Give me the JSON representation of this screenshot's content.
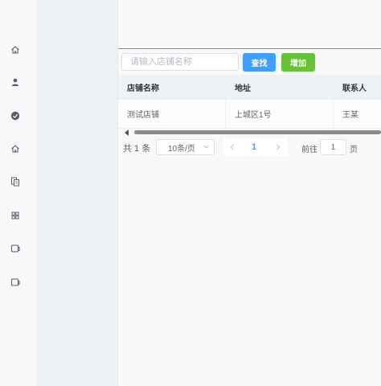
{
  "sidebar": {
    "icons": [
      {
        "name": "home-icon"
      },
      {
        "name": "user-icon"
      },
      {
        "name": "check-circle-icon"
      },
      {
        "name": "home-icon"
      },
      {
        "name": "document-copy-icon"
      },
      {
        "name": "grid-icon"
      },
      {
        "name": "tablet-icon"
      },
      {
        "name": "tablet-icon"
      }
    ]
  },
  "search": {
    "placeholder": "请输入店铺名称",
    "value": ""
  },
  "toolbar": {
    "search_label": "查找",
    "add_label": "增加"
  },
  "colors": {
    "primary": "#409eff",
    "success": "#67c23a"
  },
  "table": {
    "columns": [
      "店铺名称",
      "地址",
      "联系人"
    ],
    "rows": [
      [
        "测试店铺",
        "上城区1号",
        "王某"
      ]
    ]
  },
  "pagination": {
    "total_label": "共 1 条",
    "page_size_label": "10条/页",
    "current_page": "1",
    "goto_label": "前往",
    "goto_value": "1",
    "goto_suffix": "页"
  }
}
